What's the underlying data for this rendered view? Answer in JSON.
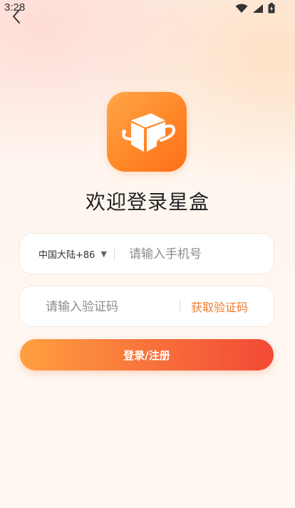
{
  "status_bar": {
    "time": "3:28",
    "icons": [
      "wifi-icon",
      "signal-icon",
      "battery-icon"
    ]
  },
  "nav": {
    "back_icon": "chevron-left-icon"
  },
  "logo": {
    "icon": "star-box-app-icon"
  },
  "title": "欢迎登录星盒",
  "phone_field": {
    "country_code": "中国大陆+86",
    "placeholder": "请输入手机号"
  },
  "code_field": {
    "placeholder": "请输入验证码",
    "get_code_label": "获取验证码"
  },
  "submit_label": "登录/注册",
  "colors": {
    "accent": "#f07a2a",
    "button_start": "#ffa040",
    "button_end": "#f24a35",
    "logo": "#ff8a2a"
  }
}
